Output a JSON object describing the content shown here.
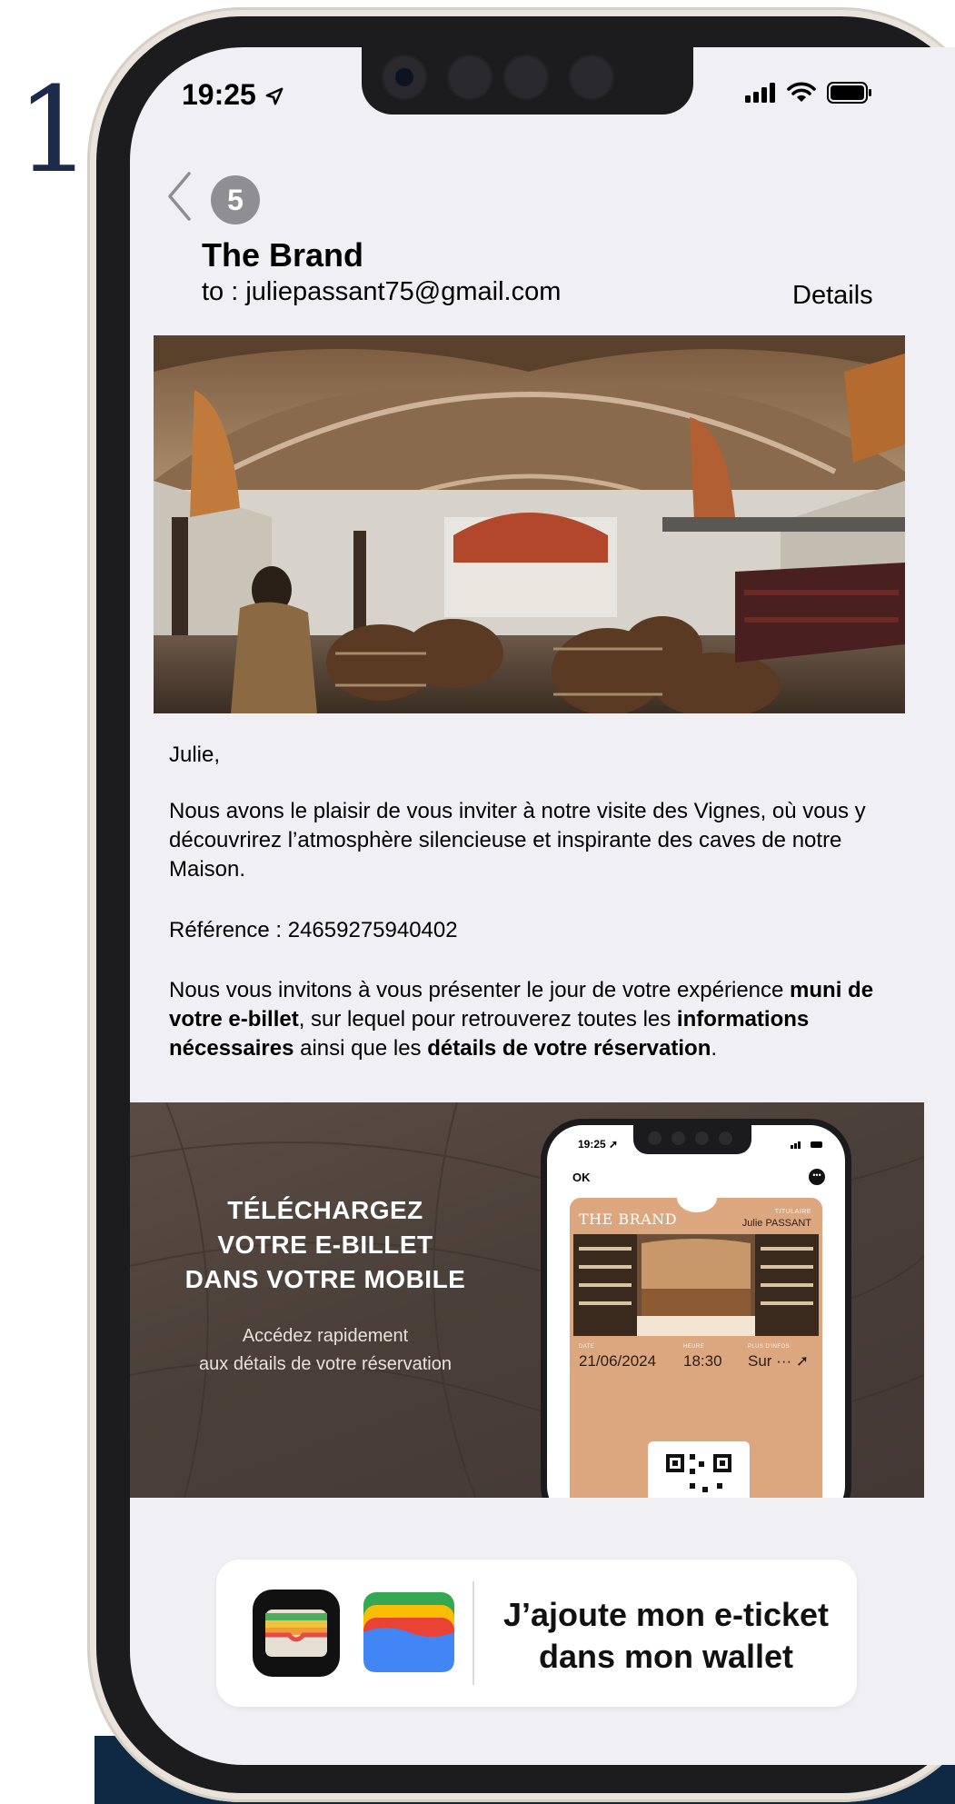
{
  "step_number": "1",
  "status_bar": {
    "time": "19:25",
    "icons": [
      "location-arrow-icon",
      "signal-bars-icon",
      "wifi-icon",
      "battery-icon"
    ]
  },
  "mail_header": {
    "unread_count": "5",
    "sender": "The Brand",
    "recipient": "to : juliepassant75@gmail.com",
    "details_label": "Details"
  },
  "mail_body": {
    "greeting": "Julie,",
    "paragraph_1": "Nous avons le plaisir de vous inviter à notre visite des Vignes, où vous y découvrirez l’atmosphère silencieuse et inspirante des caves de notre Maison.",
    "reference": "Référence : 24659275940402",
    "paragraph_2": {
      "part_1": "Nous vous invitons à vous présenter le jour de votre expérience ",
      "bold_1": "muni de votre e-billet",
      "part_2": ", sur lequel pour retrouverez toutes les ",
      "bold_2": "informations nécessaires",
      "part_3": " ainsi que les ",
      "bold_3": "détails de votre réservation",
      "part_4": "."
    }
  },
  "banner": {
    "title_line_1": "TÉLÉCHARGEZ",
    "title_line_2": "VOTRE E-BILLET",
    "title_line_3": "DANS VOTRE MOBILE",
    "subtitle_line_1": "Accédez rapidement",
    "subtitle_line_2": "aux détails de votre réservation",
    "background_color": "#4b4039"
  },
  "ticket_preview": {
    "time": "19:25",
    "ok_label": "OK",
    "brand": "THE BRAND",
    "holder_label": "TITULAIRE",
    "holder": "Julie PASSANT",
    "date_label": "DATE",
    "date": "21/06/2024",
    "time_label": "HEURE",
    "time_value": "18:30",
    "more_label": "PLUS D'INFOS",
    "more_value": "Sur ···",
    "ticket_color": "#dca67f"
  },
  "wallet_cta": {
    "line_1": "J’ajoute mon e-ticket",
    "line_2": "dans mon wallet",
    "icons": [
      "apple-wallet-icon",
      "google-wallet-icon"
    ]
  },
  "colors": {
    "screen_background": "#efeff4",
    "bezel": "#1c1c1e",
    "navy_accent": "#0f2844"
  }
}
